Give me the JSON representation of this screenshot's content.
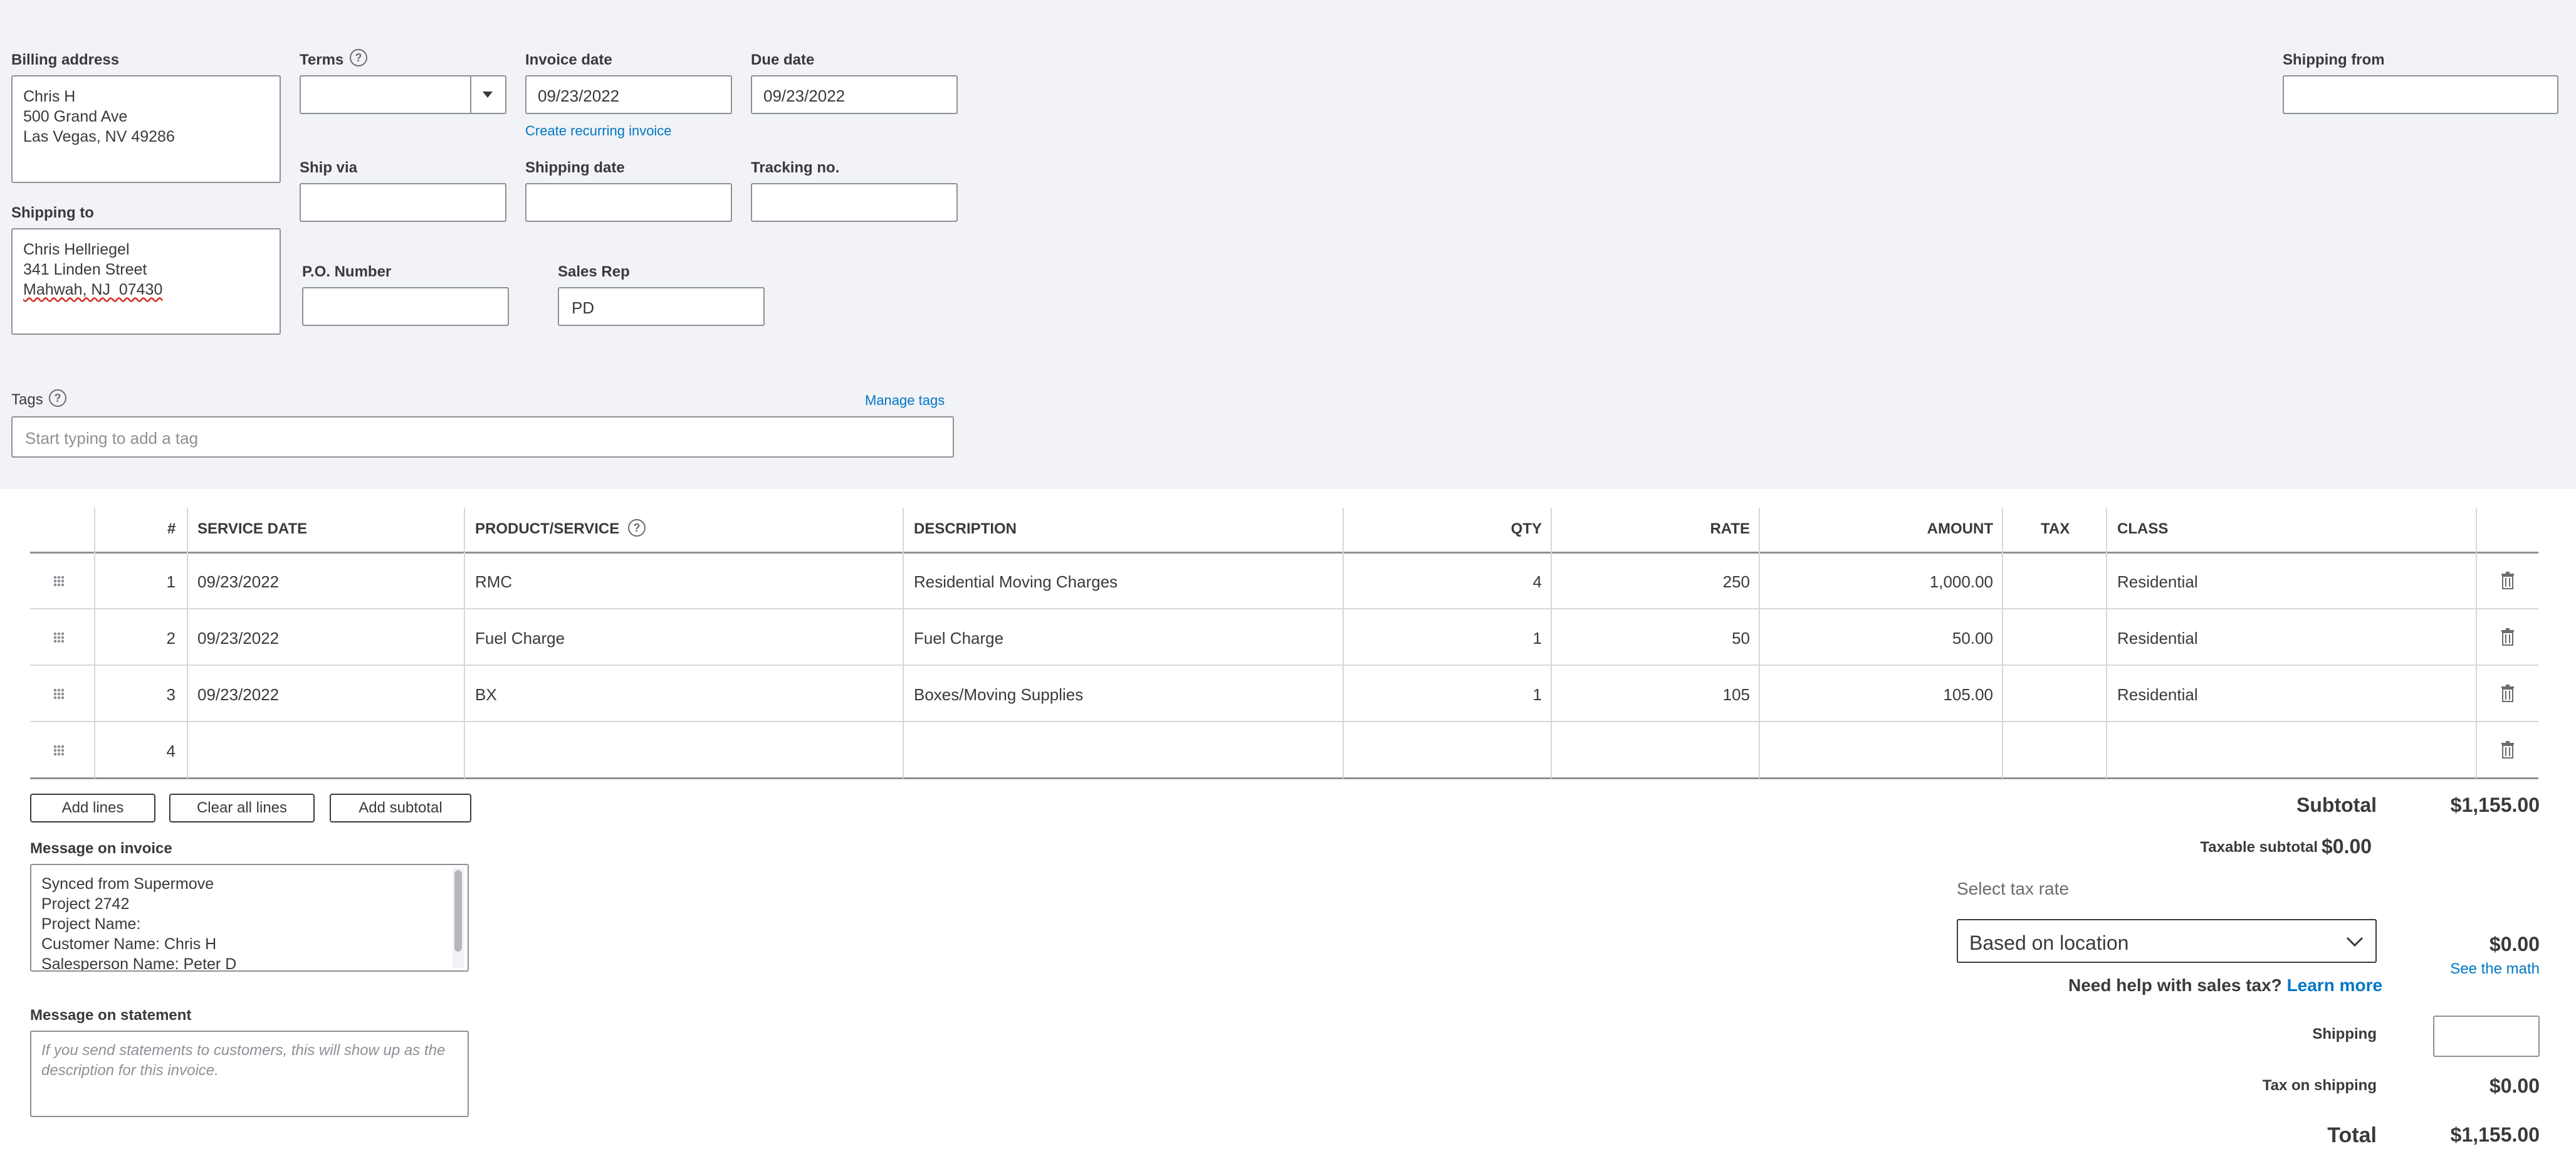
{
  "billing": {
    "billing_address_label": "Billing address",
    "billing_lines": [
      "Chris H",
      "500 Grand Ave",
      "Las Vegas, NV 49286"
    ],
    "shipping_to_label": "Shipping to",
    "shipping_lines": [
      "Chris Hellriegel",
      "341 Linden Street",
      "Mahwah, NJ  07430"
    ]
  },
  "fields": {
    "terms_label": "Terms",
    "terms_value": "",
    "invoice_date_label": "Invoice date",
    "invoice_date_value": "09/23/2022",
    "due_date_label": "Due date",
    "due_date_value": "09/23/2022",
    "create_recurring_link": "Create recurring invoice",
    "ship_via_label": "Ship via",
    "shipping_date_label": "Shipping date",
    "tracking_label": "Tracking no.",
    "po_label": "P.O. Number",
    "sales_rep_label": "Sales Rep",
    "sales_rep_value": "PD",
    "shipping_from_label": "Shipping from"
  },
  "tags": {
    "label": "Tags",
    "manage_link": "Manage tags",
    "placeholder": "Start typing to add a tag"
  },
  "table": {
    "headers": {
      "num": "#",
      "service_date": "SERVICE DATE",
      "product": "PRODUCT/SERVICE",
      "description": "DESCRIPTION",
      "qty": "QTY",
      "rate": "RATE",
      "amount": "AMOUNT",
      "tax": "TAX",
      "class": "CLASS"
    },
    "rows": [
      {
        "num": "1",
        "service_date": "09/23/2022",
        "product": "RMC",
        "description": "Residential Moving Charges",
        "qty": "4",
        "rate": "250",
        "amount": "1,000.00",
        "tax": "",
        "class": "Residential"
      },
      {
        "num": "2",
        "service_date": "09/23/2022",
        "product": "Fuel Charge",
        "description": "Fuel Charge",
        "qty": "1",
        "rate": "50",
        "amount": "50.00",
        "tax": "",
        "class": "Residential"
      },
      {
        "num": "3",
        "service_date": "09/23/2022",
        "product": "BX",
        "description": "Boxes/Moving Supplies",
        "qty": "1",
        "rate": "105",
        "amount": "105.00",
        "tax": "",
        "class": "Residential"
      },
      {
        "num": "4",
        "service_date": "",
        "product": "",
        "description": "",
        "qty": "",
        "rate": "",
        "amount": "",
        "tax": "",
        "class": ""
      }
    ]
  },
  "buttons": {
    "add_lines": "Add lines",
    "clear_all": "Clear all lines",
    "add_subtotal": "Add subtotal"
  },
  "messages": {
    "invoice_label": "Message on invoice",
    "invoice_lines": [
      "Synced from Supermove",
      "Project 2742",
      "Project Name:",
      "Customer Name: Chris H",
      "Salesperson Name: Peter D"
    ],
    "statement_label": "Message on statement",
    "statement_placeholder": "If you send statements to customers, this will show up as the description for this invoice."
  },
  "summary": {
    "subtotal_label": "Subtotal",
    "subtotal_value": "$1,155.00",
    "taxable_label": "Taxable subtotal",
    "taxable_value": "$0.00",
    "select_tax_label": "Select tax rate",
    "tax_rate_value": "Based on location",
    "tax_value": "$0.00",
    "see_math": "See the math",
    "help_text": "Need help with sales tax?",
    "learn_more": "Learn more",
    "shipping_label": "Shipping",
    "tax_on_shipping_label": "Tax on shipping",
    "tax_on_shipping_value": "$0.00",
    "total_label": "Total",
    "total_value": "$1,155.00"
  }
}
